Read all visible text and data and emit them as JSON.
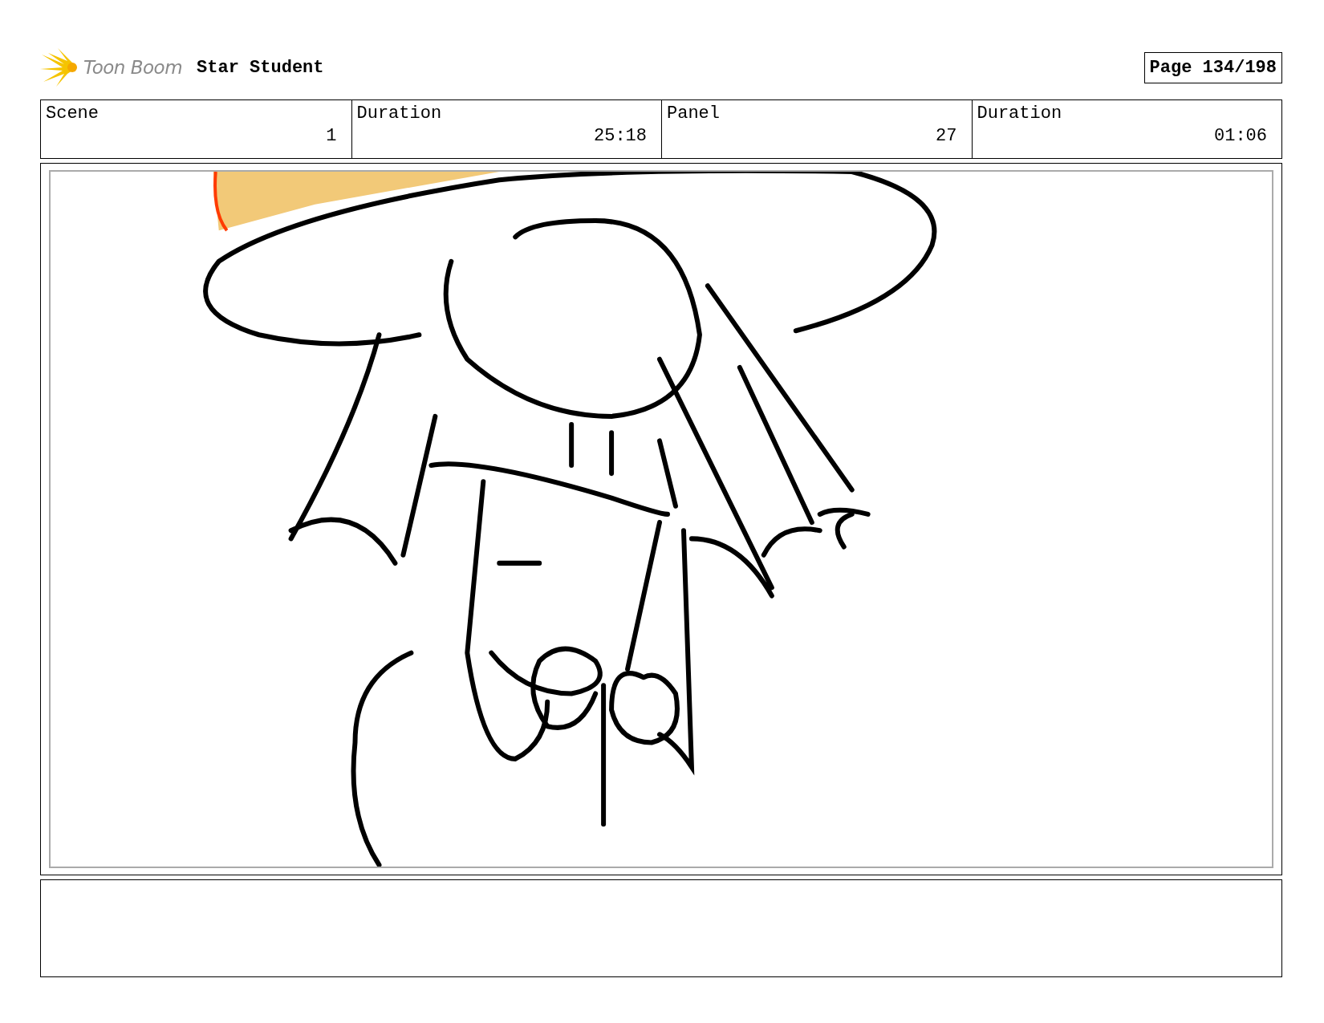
{
  "header": {
    "logo": "Toon Boom",
    "project": "Star Student",
    "page": "Page 134/198"
  },
  "info": [
    {
      "label": "Scene",
      "value": "1"
    },
    {
      "label": "Duration",
      "value": "25:18"
    },
    {
      "label": "Panel",
      "value": "27"
    },
    {
      "label": "Duration",
      "value": "01:06"
    }
  ]
}
